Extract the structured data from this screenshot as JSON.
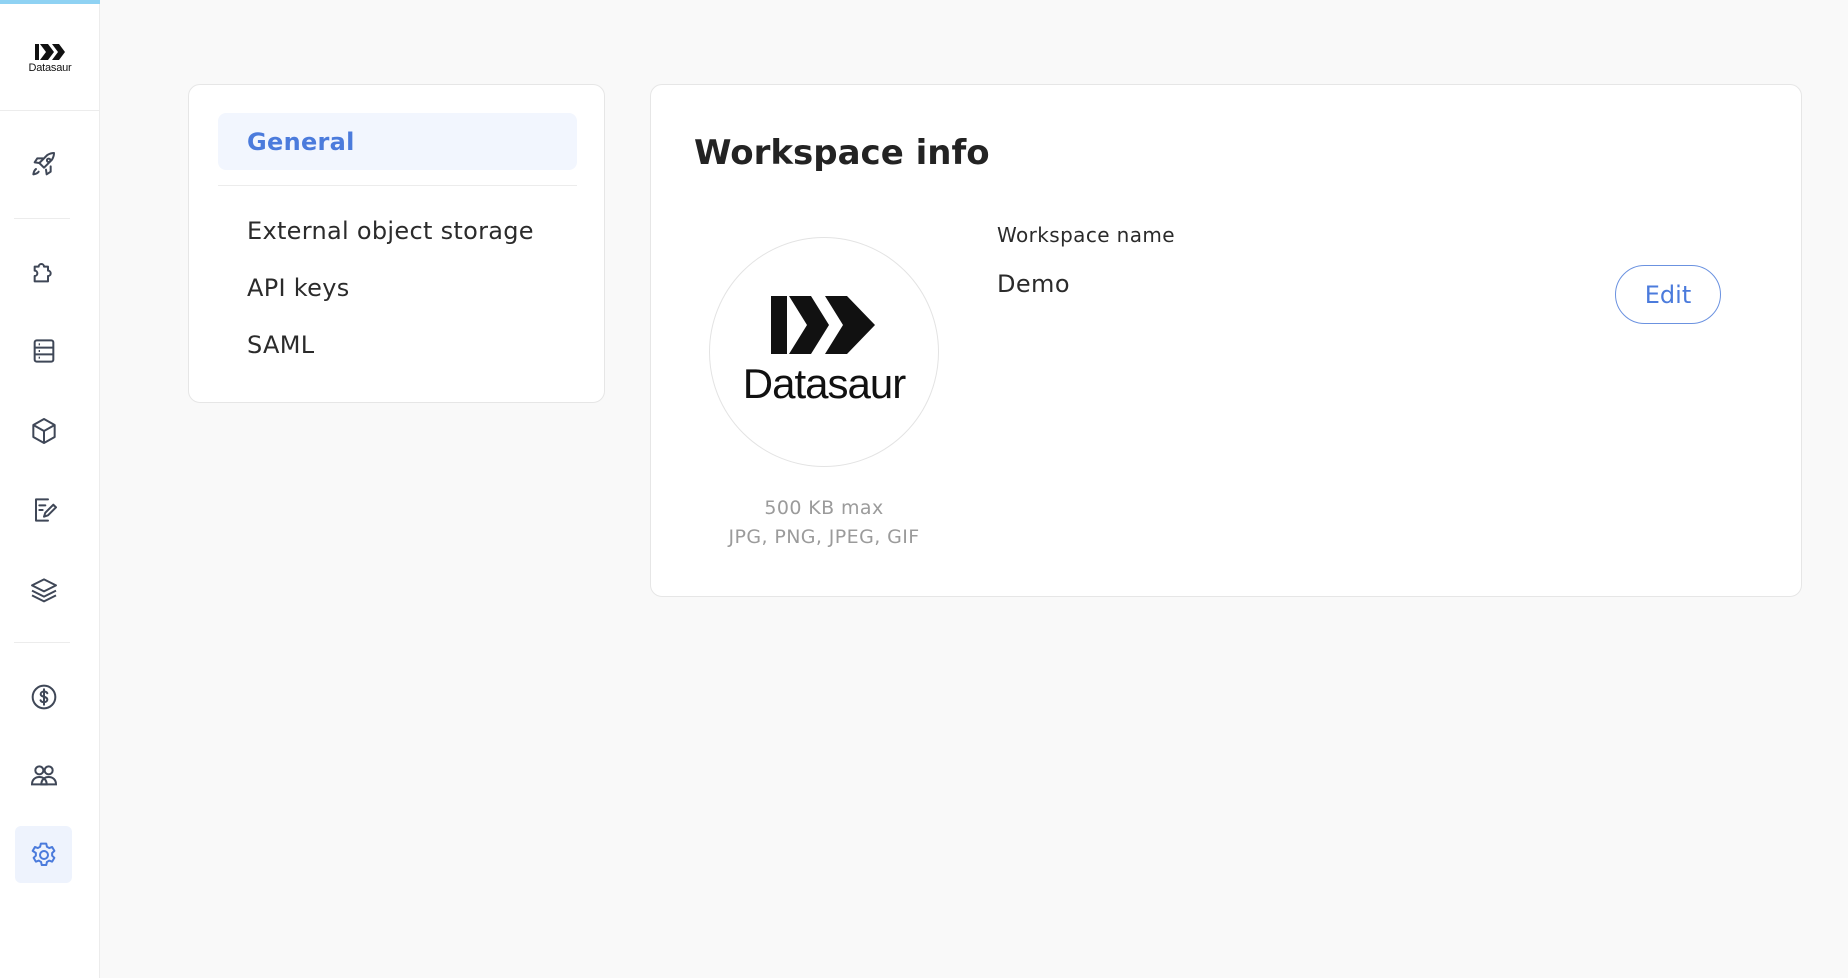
{
  "sidebar": {
    "logo_text": "Datasaur",
    "accent_color": "#8fd2f3",
    "items": [
      {
        "icon": "rocket-icon"
      },
      {
        "icon": "puzzle-icon"
      },
      {
        "icon": "database-icon"
      },
      {
        "icon": "cube-icon"
      },
      {
        "icon": "document-edit-icon"
      },
      {
        "icon": "layers-icon"
      },
      {
        "icon": "dollar-icon"
      },
      {
        "icon": "users-icon"
      },
      {
        "icon": "gear-icon",
        "active": true
      }
    ]
  },
  "settings_menu": {
    "items": [
      {
        "label": "General",
        "active": true
      },
      {
        "label": "External object storage"
      },
      {
        "label": "API keys"
      },
      {
        "label": "SAML"
      }
    ]
  },
  "workspace": {
    "title": "Workspace info",
    "logo_brand_text": "Datasaur",
    "size_hint": "500 KB max",
    "formats_hint": "JPG, PNG, JPEG, GIF",
    "name_label": "Workspace name",
    "name_value": "Demo",
    "edit_label": "Edit"
  },
  "colors": {
    "primary": "#4b7bdc",
    "active_bg": "#f2f6fe"
  }
}
